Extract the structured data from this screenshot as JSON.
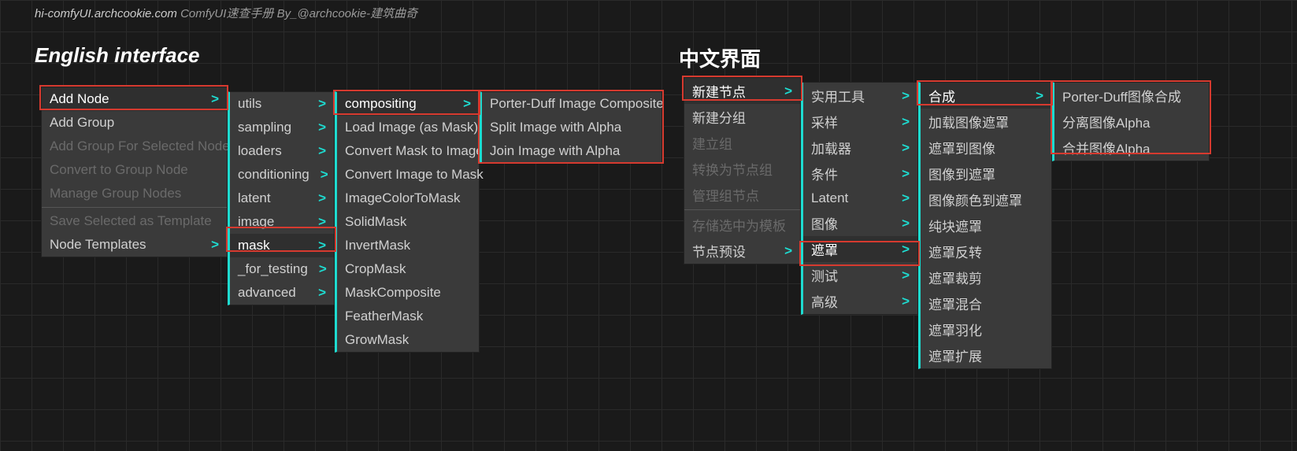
{
  "header": {
    "site": "hi-comfyUI.archcookie.com",
    "tagline": "ComfyUI速查手册 By_@archcookie-建筑曲奇"
  },
  "en": {
    "title": "English interface",
    "col1": {
      "addNode": "Add Node",
      "addGroup": "Add Group",
      "addGroupSel": "Add Group For Selected Nodes",
      "convertGroup": "Convert to Group Node",
      "manageGroup": "Manage Group Nodes",
      "saveTpl": "Save Selected as Template",
      "nodeTpl": "Node Templates"
    },
    "col2": {
      "utils": "utils",
      "sampling": "sampling",
      "loaders": "loaders",
      "conditioning": "conditioning",
      "latent": "latent",
      "image": "image",
      "mask": "mask",
      "forTesting": "_for_testing",
      "advanced": "advanced"
    },
    "col3": {
      "compositing": "compositing",
      "loadImageMask": "Load Image (as Mask)",
      "convMaskImg": "Convert Mask to Image",
      "convImgMask": "Convert Image to Mask",
      "imgColorMask": "ImageColorToMask",
      "solidMask": "SolidMask",
      "invertMask": "InvertMask",
      "cropMask": "CropMask",
      "maskComposite": "MaskComposite",
      "featherMask": "FeatherMask",
      "growMask": "GrowMask"
    },
    "col4": {
      "porterDuff": "Porter-Duff Image Composite",
      "splitAlpha": "Split Image with Alpha",
      "joinAlpha": "Join Image with Alpha"
    }
  },
  "zh": {
    "title": "中文界面",
    "col1": {
      "addNode": "新建节点",
      "addGroup": "新建分组",
      "addGroupSel": "建立组",
      "convertGroup": "转换为节点组",
      "manageGroup": "管理组节点",
      "saveTpl": "存储选中为模板",
      "nodeTpl": "节点预设"
    },
    "col2": {
      "utils": "实用工具",
      "sampling": "采样",
      "loaders": "加载器",
      "conditioning": "条件",
      "latent": "Latent",
      "image": "图像",
      "mask": "遮罩",
      "forTesting": "测试",
      "advanced": "高级"
    },
    "col3": {
      "compositing": "合成",
      "loadImageMask": "加载图像遮罩",
      "convMaskImg": "遮罩到图像",
      "convImgMask": "图像到遮罩",
      "imgColorMask": "图像颜色到遮罩",
      "solidMask": "纯块遮罩",
      "invertMask": "遮罩反转",
      "cropMask": "遮罩裁剪",
      "maskComposite": "遮罩混合",
      "featherMask": "遮罩羽化",
      "growMask": "遮罩扩展"
    },
    "col4": {
      "porterDuff": "Porter-Duff图像合成",
      "splitAlpha": "分离图像Alpha",
      "joinAlpha": "合并图像Alpha"
    }
  }
}
